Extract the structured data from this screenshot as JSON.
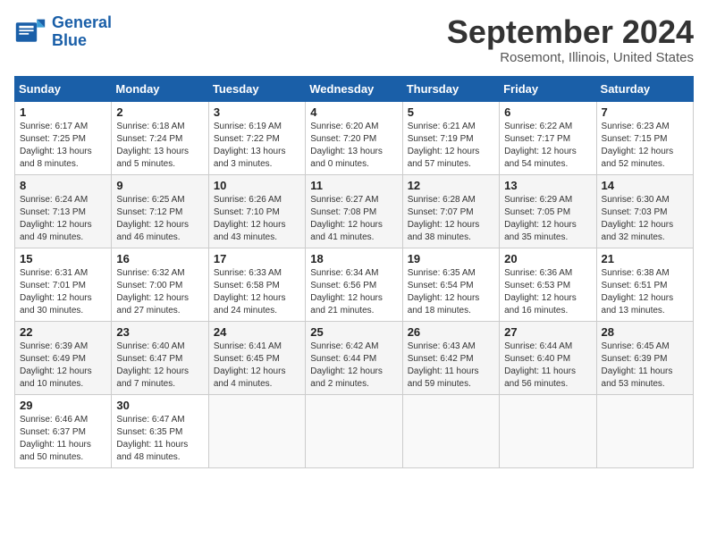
{
  "header": {
    "logo_line1": "General",
    "logo_line2": "Blue",
    "month": "September 2024",
    "location": "Rosemont, Illinois, United States"
  },
  "weekdays": [
    "Sunday",
    "Monday",
    "Tuesday",
    "Wednesday",
    "Thursday",
    "Friday",
    "Saturday"
  ],
  "weeks": [
    [
      {
        "day": "1",
        "sunrise": "6:17 AM",
        "sunset": "7:25 PM",
        "daylight": "13 hours and 8 minutes."
      },
      {
        "day": "2",
        "sunrise": "6:18 AM",
        "sunset": "7:24 PM",
        "daylight": "13 hours and 5 minutes."
      },
      {
        "day": "3",
        "sunrise": "6:19 AM",
        "sunset": "7:22 PM",
        "daylight": "13 hours and 3 minutes."
      },
      {
        "day": "4",
        "sunrise": "6:20 AM",
        "sunset": "7:20 PM",
        "daylight": "13 hours and 0 minutes."
      },
      {
        "day": "5",
        "sunrise": "6:21 AM",
        "sunset": "7:19 PM",
        "daylight": "12 hours and 57 minutes."
      },
      {
        "day": "6",
        "sunrise": "6:22 AM",
        "sunset": "7:17 PM",
        "daylight": "12 hours and 54 minutes."
      },
      {
        "day": "7",
        "sunrise": "6:23 AM",
        "sunset": "7:15 PM",
        "daylight": "12 hours and 52 minutes."
      }
    ],
    [
      {
        "day": "8",
        "sunrise": "6:24 AM",
        "sunset": "7:13 PM",
        "daylight": "12 hours and 49 minutes."
      },
      {
        "day": "9",
        "sunrise": "6:25 AM",
        "sunset": "7:12 PM",
        "daylight": "12 hours and 46 minutes."
      },
      {
        "day": "10",
        "sunrise": "6:26 AM",
        "sunset": "7:10 PM",
        "daylight": "12 hours and 43 minutes."
      },
      {
        "day": "11",
        "sunrise": "6:27 AM",
        "sunset": "7:08 PM",
        "daylight": "12 hours and 41 minutes."
      },
      {
        "day": "12",
        "sunrise": "6:28 AM",
        "sunset": "7:07 PM",
        "daylight": "12 hours and 38 minutes."
      },
      {
        "day": "13",
        "sunrise": "6:29 AM",
        "sunset": "7:05 PM",
        "daylight": "12 hours and 35 minutes."
      },
      {
        "day": "14",
        "sunrise": "6:30 AM",
        "sunset": "7:03 PM",
        "daylight": "12 hours and 32 minutes."
      }
    ],
    [
      {
        "day": "15",
        "sunrise": "6:31 AM",
        "sunset": "7:01 PM",
        "daylight": "12 hours and 30 minutes."
      },
      {
        "day": "16",
        "sunrise": "6:32 AM",
        "sunset": "7:00 PM",
        "daylight": "12 hours and 27 minutes."
      },
      {
        "day": "17",
        "sunrise": "6:33 AM",
        "sunset": "6:58 PM",
        "daylight": "12 hours and 24 minutes."
      },
      {
        "day": "18",
        "sunrise": "6:34 AM",
        "sunset": "6:56 PM",
        "daylight": "12 hours and 21 minutes."
      },
      {
        "day": "19",
        "sunrise": "6:35 AM",
        "sunset": "6:54 PM",
        "daylight": "12 hours and 18 minutes."
      },
      {
        "day": "20",
        "sunrise": "6:36 AM",
        "sunset": "6:53 PM",
        "daylight": "12 hours and 16 minutes."
      },
      {
        "day": "21",
        "sunrise": "6:38 AM",
        "sunset": "6:51 PM",
        "daylight": "12 hours and 13 minutes."
      }
    ],
    [
      {
        "day": "22",
        "sunrise": "6:39 AM",
        "sunset": "6:49 PM",
        "daylight": "12 hours and 10 minutes."
      },
      {
        "day": "23",
        "sunrise": "6:40 AM",
        "sunset": "6:47 PM",
        "daylight": "12 hours and 7 minutes."
      },
      {
        "day": "24",
        "sunrise": "6:41 AM",
        "sunset": "6:45 PM",
        "daylight": "12 hours and 4 minutes."
      },
      {
        "day": "25",
        "sunrise": "6:42 AM",
        "sunset": "6:44 PM",
        "daylight": "12 hours and 2 minutes."
      },
      {
        "day": "26",
        "sunrise": "6:43 AM",
        "sunset": "6:42 PM",
        "daylight": "11 hours and 59 minutes."
      },
      {
        "day": "27",
        "sunrise": "6:44 AM",
        "sunset": "6:40 PM",
        "daylight": "11 hours and 56 minutes."
      },
      {
        "day": "28",
        "sunrise": "6:45 AM",
        "sunset": "6:39 PM",
        "daylight": "11 hours and 53 minutes."
      }
    ],
    [
      {
        "day": "29",
        "sunrise": "6:46 AM",
        "sunset": "6:37 PM",
        "daylight": "11 hours and 50 minutes."
      },
      {
        "day": "30",
        "sunrise": "6:47 AM",
        "sunset": "6:35 PM",
        "daylight": "11 hours and 48 minutes."
      },
      null,
      null,
      null,
      null,
      null
    ]
  ]
}
